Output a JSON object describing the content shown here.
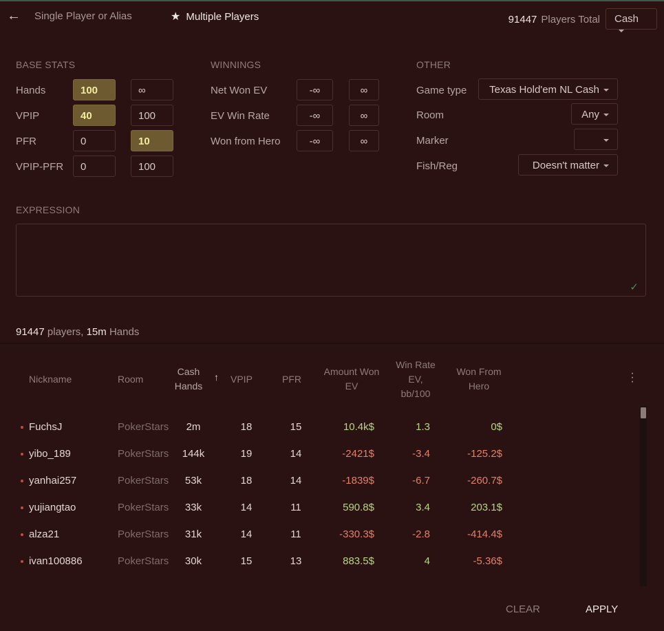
{
  "header": {
    "single_label": "Single Player or Alias",
    "multi_label": "Multiple Players",
    "total_count": "91447",
    "total_label": "Players Total",
    "game_mode": "Cash"
  },
  "base_stats": {
    "title": "BASE STATS",
    "rows": [
      {
        "label": "Hands",
        "min": "100",
        "max": "∞"
      },
      {
        "label": "VPIP",
        "min": "40",
        "max": "100"
      },
      {
        "label": "PFR",
        "min": "0",
        "max": "10"
      },
      {
        "label": "VPIP-PFR",
        "min": "0",
        "max": "100"
      }
    ]
  },
  "winnings": {
    "title": "WINNINGS",
    "rows": [
      {
        "label": "Net Won EV",
        "min": "-∞",
        "max": "∞"
      },
      {
        "label": "EV Win Rate",
        "min": "-∞",
        "max": "∞"
      },
      {
        "label": "Won from Hero",
        "min": "-∞",
        "max": "∞"
      }
    ]
  },
  "other": {
    "title": "OTHER",
    "rows": [
      {
        "label": "Game type",
        "value": "Texas Hold'em NL Cash"
      },
      {
        "label": "Room",
        "value": "Any"
      },
      {
        "label": "Marker",
        "value": ""
      },
      {
        "label": "Fish/Reg",
        "value": "Doesn't matter"
      }
    ]
  },
  "expression": {
    "title": "EXPRESSION",
    "value": ""
  },
  "summary": {
    "players": "91447",
    "players_label": "players,",
    "hands": "15m",
    "hands_label": "Hands"
  },
  "table": {
    "columns": {
      "nickname": "Nickname",
      "room": "Room",
      "cash_hands_1": "Cash",
      "cash_hands_2": "Hands",
      "vpip": "VPIP",
      "pfr": "PFR",
      "amount_1": "Amount Won",
      "amount_2": "EV",
      "winrate_1": "Win Rate",
      "winrate_2": "EV,",
      "winrate_3": "bb/100",
      "wfh_1": "Won From",
      "wfh_2": "Hero"
    },
    "rows": [
      {
        "nick": "FuchsJ",
        "room": "PokerStars",
        "hands": "2m",
        "vpip": "18",
        "pfr": "15",
        "amount": "10.4k$",
        "winrate": "1.3",
        "wfh": "0$",
        "amount_pos": true,
        "wr_pos": true,
        "wfh_pos": true
      },
      {
        "nick": "yibo_189",
        "room": "PokerStars",
        "hands": "144k",
        "vpip": "19",
        "pfr": "14",
        "amount": "-2421$",
        "winrate": "-3.4",
        "wfh": "-125.2$",
        "amount_pos": false,
        "wr_pos": false,
        "wfh_pos": false
      },
      {
        "nick": "yanhai257",
        "room": "PokerStars",
        "hands": "53k",
        "vpip": "18",
        "pfr": "14",
        "amount": "-1839$",
        "winrate": "-6.7",
        "wfh": "-260.7$",
        "amount_pos": false,
        "wr_pos": false,
        "wfh_pos": false
      },
      {
        "nick": "yujiangtao",
        "room": "PokerStars",
        "hands": "33k",
        "vpip": "14",
        "pfr": "11",
        "amount": "590.8$",
        "winrate": "3.4",
        "wfh": "203.1$",
        "amount_pos": true,
        "wr_pos": true,
        "wfh_pos": true
      },
      {
        "nick": "alza21",
        "room": "PokerStars",
        "hands": "31k",
        "vpip": "14",
        "pfr": "11",
        "amount": "-330.3$",
        "winrate": "-2.8",
        "wfh": "-414.4$",
        "amount_pos": false,
        "wr_pos": false,
        "wfh_pos": false
      },
      {
        "nick": "ivan100886",
        "room": "PokerStars",
        "hands": "30k",
        "vpip": "15",
        "pfr": "13",
        "amount": "883.5$",
        "winrate": "4",
        "wfh": "-5.36$",
        "amount_pos": true,
        "wr_pos": true,
        "wfh_pos": false
      }
    ]
  },
  "footer": {
    "clear": "CLEAR",
    "apply": "APPLY"
  },
  "colors": {
    "background": "#2a1212",
    "highlight": "#6e5a30",
    "positive": "#b8d487",
    "negative": "#e0806c"
  }
}
